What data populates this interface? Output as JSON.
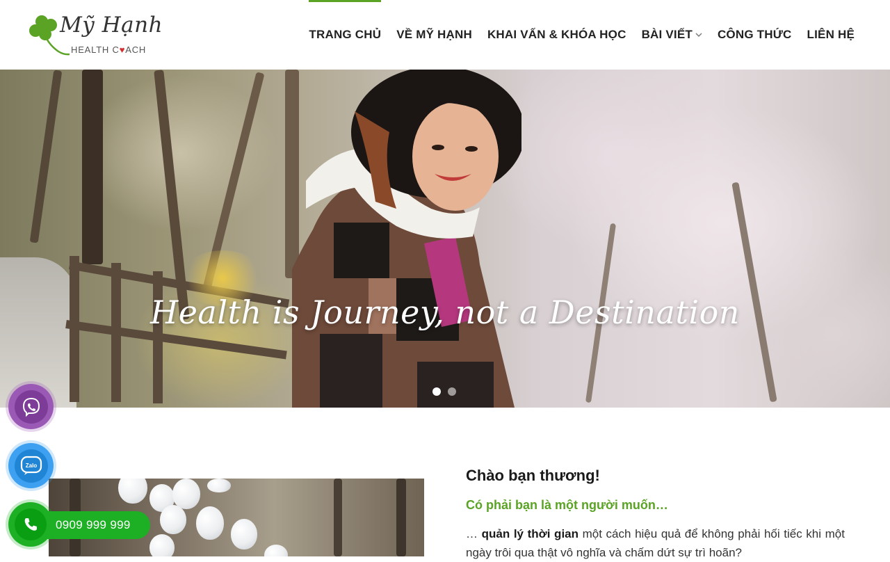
{
  "brand": {
    "script_name": "Mỹ Hạnh",
    "tagline_left": "HEALTH C",
    "tagline_right": "ACH",
    "accent_color": "#5aa324"
  },
  "nav": {
    "items": [
      {
        "label": "TRANG CHỦ",
        "active": true
      },
      {
        "label": "VỀ MỸ HẠNH",
        "active": false
      },
      {
        "label": "KHAI VẤN & KHÓA HỌC",
        "active": false
      },
      {
        "label": "BÀI VIẾT",
        "active": false,
        "has_dropdown": true
      },
      {
        "label": "CÔNG THỨC",
        "active": false
      },
      {
        "label": "LIÊN HỆ",
        "active": false
      }
    ]
  },
  "hero": {
    "title": "Health is Journey, not a Destination",
    "slides": 2,
    "active_slide": 1
  },
  "intro": {
    "heading": "Chào bạn thương!",
    "subheading": "Có phải bạn là một người muốn…",
    "text_prefix": "… ",
    "text_bold": "quản lý thời gian",
    "text_rest": " một cách hiệu quả để không phải hối tiếc khi một ngày trôi qua thật vô nghĩa và chấm dứt sự trì hoãn?"
  },
  "contact": {
    "viber_icon": "viber-icon",
    "zalo_label": "Zalo",
    "phone_number": "0909 999 999",
    "phone_color": "#1db024",
    "viber_color": "#9b59b6",
    "zalo_color": "#3ea0f0"
  }
}
